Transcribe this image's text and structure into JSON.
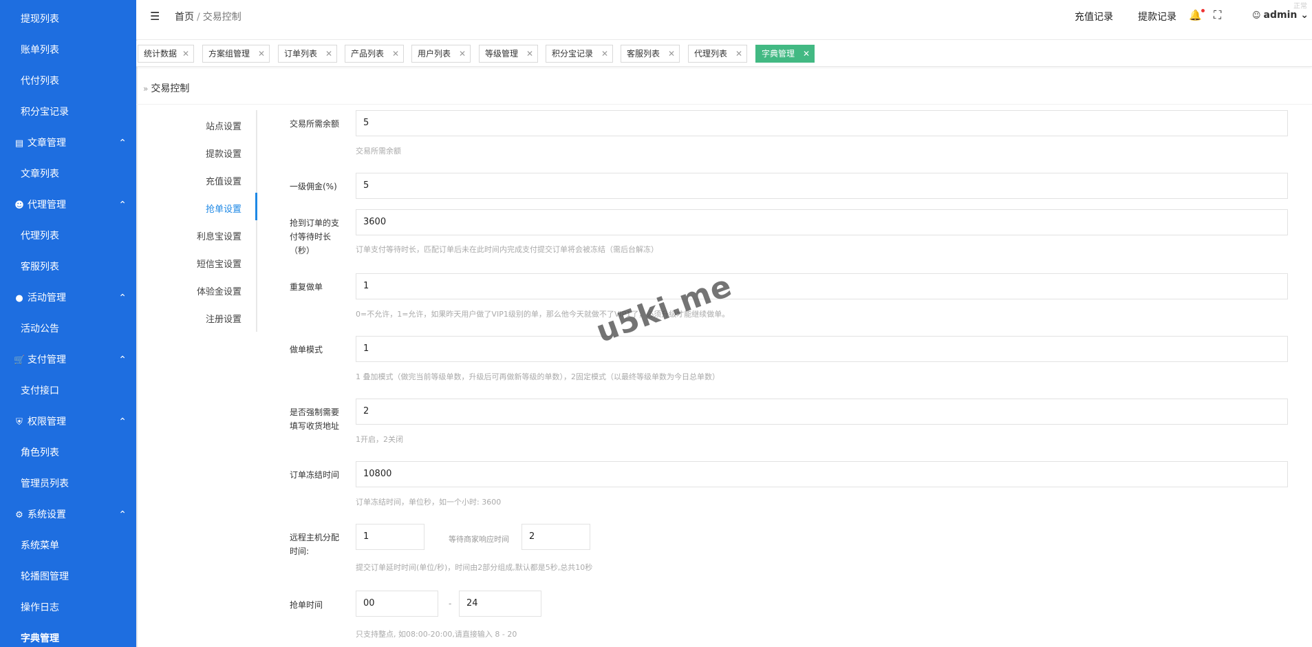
{
  "sidebar": {
    "items": [
      {
        "label": "提现列表",
        "type": "sub"
      },
      {
        "label": "账单列表",
        "type": "sub"
      },
      {
        "label": "代付列表",
        "type": "sub"
      },
      {
        "label": "积分宝记录",
        "type": "sub"
      },
      {
        "label": "文章管理",
        "type": "group",
        "icon": "document-icon"
      },
      {
        "label": "文章列表",
        "type": "sub"
      },
      {
        "label": "代理管理",
        "type": "group",
        "icon": "user-icon"
      },
      {
        "label": "代理列表",
        "type": "sub"
      },
      {
        "label": "客服列表",
        "type": "sub"
      },
      {
        "label": "活动管理",
        "type": "group",
        "icon": "circle-icon"
      },
      {
        "label": "活动公告",
        "type": "sub"
      },
      {
        "label": "支付管理",
        "type": "group",
        "icon": "cart-icon"
      },
      {
        "label": "支付接口",
        "type": "sub"
      },
      {
        "label": "权限管理",
        "type": "group",
        "icon": "shield-icon"
      },
      {
        "label": "角色列表",
        "type": "sub"
      },
      {
        "label": "管理员列表",
        "type": "sub"
      },
      {
        "label": "系统设置",
        "type": "group",
        "icon": "gear-icon"
      },
      {
        "label": "系统菜单",
        "type": "sub"
      },
      {
        "label": "轮播图管理",
        "type": "sub"
      },
      {
        "label": "操作日志",
        "type": "sub"
      },
      {
        "label": "字典管理",
        "type": "sub",
        "active": true
      }
    ],
    "bg_color": "#1e6ee0"
  },
  "topbar": {
    "breadcrumb_home": "首页",
    "breadcrumb_sep": "/",
    "breadcrumb_current": "交易控制",
    "recharge_link": "充值记录",
    "withdraw_link": "提款记录",
    "user_name": "admin",
    "corner_text": "正常"
  },
  "tabs": [
    {
      "label": "统计数据"
    },
    {
      "label": "方案组管理"
    },
    {
      "label": "订单列表"
    },
    {
      "label": "产品列表"
    },
    {
      "label": "用户列表"
    },
    {
      "label": "等级管理"
    },
    {
      "label": "积分宝记录"
    },
    {
      "label": "客服列表"
    },
    {
      "label": "代理列表"
    },
    {
      "label": "字典管理",
      "active": true,
      "color": "#42b983"
    }
  ],
  "page": {
    "title": "交易控制"
  },
  "subnav": [
    {
      "label": "站点设置"
    },
    {
      "label": "提款设置"
    },
    {
      "label": "充值设置"
    },
    {
      "label": "抢单设置",
      "active": true
    },
    {
      "label": "利息宝设置"
    },
    {
      "label": "短信宝设置"
    },
    {
      "label": "体验金设置"
    },
    {
      "label": "注册设置"
    }
  ],
  "form": {
    "balance_label": "交易所需余额",
    "balance_value": "5",
    "balance_hint": "交易所需余额",
    "commission_label": "一级佣金(%)",
    "commission_value": "5",
    "pay_wait_label": "抢到订单的支付等待时长（秒）",
    "pay_wait_value": "3600",
    "pay_wait_hint": "订单支付等待时长，匹配订单后未在此时间内完成支付提交订单将会被冻结（需后台解冻）",
    "repeat_label": "重复做单",
    "repeat_value": "1",
    "repeat_hint": "0=不允许，1=允许，如果昨天用户做了VIP1级别的单，那么他今天就做不了VIP1了，必须升级才能继续做单。",
    "mode_label": "做单模式",
    "mode_value": "1",
    "mode_hint": "1 叠加模式（做完当前等级单数，升级后可再做新等级的单数），2固定模式（以最终等级单数为今日总单数）",
    "address_label": "是否强制需要填写收货地址",
    "address_value": "2",
    "address_hint": "1开启，2关闭",
    "freeze_label": "订单冻结时间",
    "freeze_value": "10800",
    "freeze_hint": "订单冻结时间，单位秒，如一个小时: 3600",
    "remote_label": "远程主机分配时间:",
    "remote_value": "1",
    "merchant_label": "等待商家响应时间",
    "merchant_value": "2",
    "remote_hint": "提交订单延时时间(单位/秒)，时间由2部分组成,默认都是5秒,总共10秒",
    "grab_label": "抢单时间",
    "grab_start": "00",
    "grab_dash": "-",
    "grab_end": "24",
    "grab_hint": "只支持整点, 如08:00-20:00,请直接输入 8 - 20"
  },
  "watermark": "u5ki.me"
}
